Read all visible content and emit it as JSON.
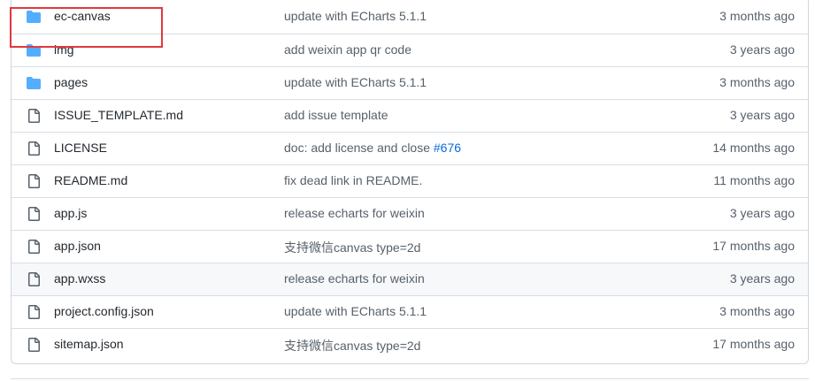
{
  "colors": {
    "folder_icon": "#54aeff",
    "file_icon": "#57606a",
    "highlight": "#e0393e",
    "link": "#0969da"
  },
  "files": [
    {
      "type": "folder",
      "icon": "folder-icon",
      "name": "ec-canvas",
      "message": "update with ECharts 5.1.1",
      "age": "3 months ago"
    },
    {
      "type": "folder",
      "icon": "folder-icon",
      "name": "img",
      "message": "add weixin app qr code",
      "age": "3 years ago"
    },
    {
      "type": "folder",
      "icon": "folder-icon",
      "name": "pages",
      "message": "update with ECharts 5.1.1",
      "age": "3 months ago"
    },
    {
      "type": "file",
      "icon": "file-icon",
      "name": "ISSUE_TEMPLATE.md",
      "message": "add issue template",
      "age": "3 years ago"
    },
    {
      "type": "file",
      "icon": "file-icon",
      "name": "LICENSE",
      "message": "doc: add license and close ",
      "message_link": "#676",
      "age": "14 months ago"
    },
    {
      "type": "file",
      "icon": "file-icon",
      "name": "README.md",
      "message": "fix dead link in README.",
      "age": "11 months ago"
    },
    {
      "type": "file",
      "icon": "file-icon",
      "name": "app.js",
      "message": "release echarts for weixin",
      "age": "3 years ago"
    },
    {
      "type": "file",
      "icon": "file-icon",
      "name": "app.json",
      "message": "支持微信canvas type=2d",
      "age": "17 months ago"
    },
    {
      "type": "file",
      "icon": "file-icon",
      "name": "app.wxss",
      "message": "release echarts for weixin",
      "age": "3 years ago"
    },
    {
      "type": "file",
      "icon": "file-icon",
      "name": "project.config.json",
      "message": "update with ECharts 5.1.1",
      "age": "3 months ago"
    },
    {
      "type": "file",
      "icon": "file-icon",
      "name": "sitemap.json",
      "message": "支持微信canvas type=2d",
      "age": "17 months ago"
    }
  ]
}
